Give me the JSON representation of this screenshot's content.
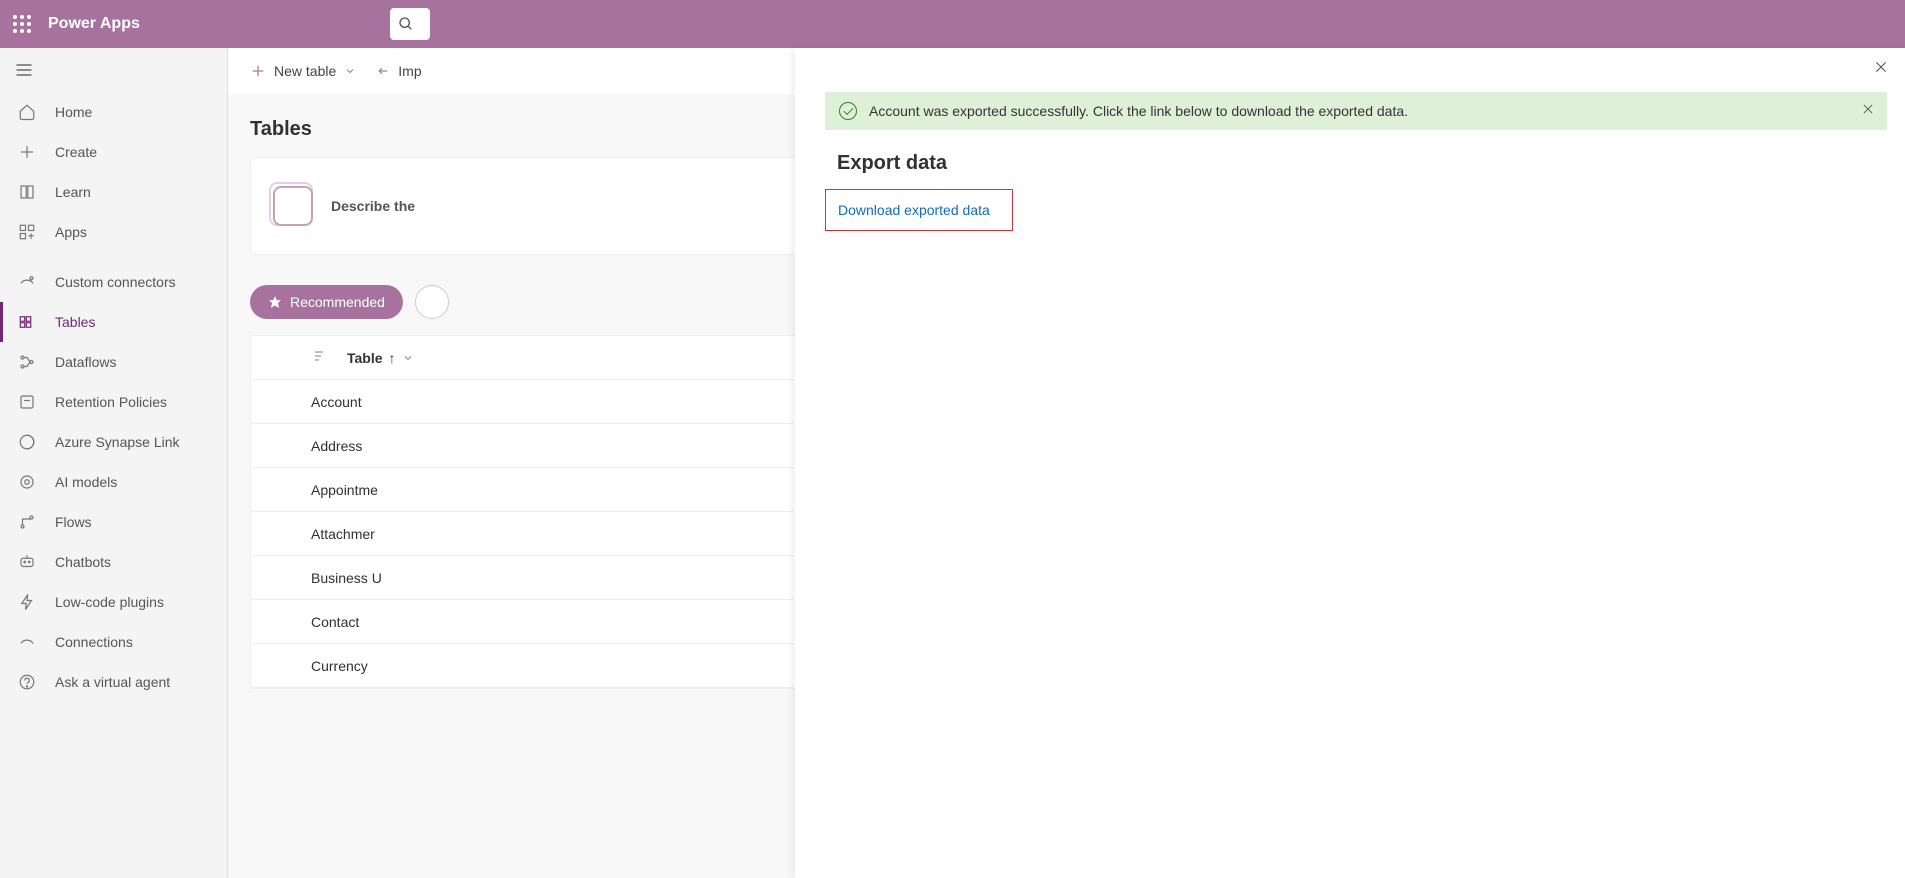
{
  "header": {
    "app_name": "Power Apps"
  },
  "sidebar": {
    "items": [
      {
        "label": "Home"
      },
      {
        "label": "Create"
      },
      {
        "label": "Learn"
      },
      {
        "label": "Apps"
      },
      {
        "label": "Custom connectors"
      },
      {
        "label": "Tables"
      },
      {
        "label": "Dataflows"
      },
      {
        "label": "Retention Policies"
      },
      {
        "label": "Azure Synapse Link"
      },
      {
        "label": "AI models"
      },
      {
        "label": "Flows"
      },
      {
        "label": "Chatbots"
      },
      {
        "label": "Low-code plugins"
      },
      {
        "label": "Connections"
      },
      {
        "label": "Ask a virtual agent"
      }
    ]
  },
  "toolbar": {
    "new_table": "New table",
    "import": "Imp"
  },
  "main": {
    "title": "Tables",
    "describe": "Describe the",
    "recommended": "Recommended",
    "col_header": "Table",
    "rows": [
      "Account",
      "Address",
      "Appointme",
      "Attachmer",
      "Business U",
      "Contact",
      "Currency"
    ]
  },
  "panel": {
    "banner": "Account was exported successfully. Click the link below to download the exported data.",
    "title": "Export data",
    "download": "Download exported data"
  }
}
